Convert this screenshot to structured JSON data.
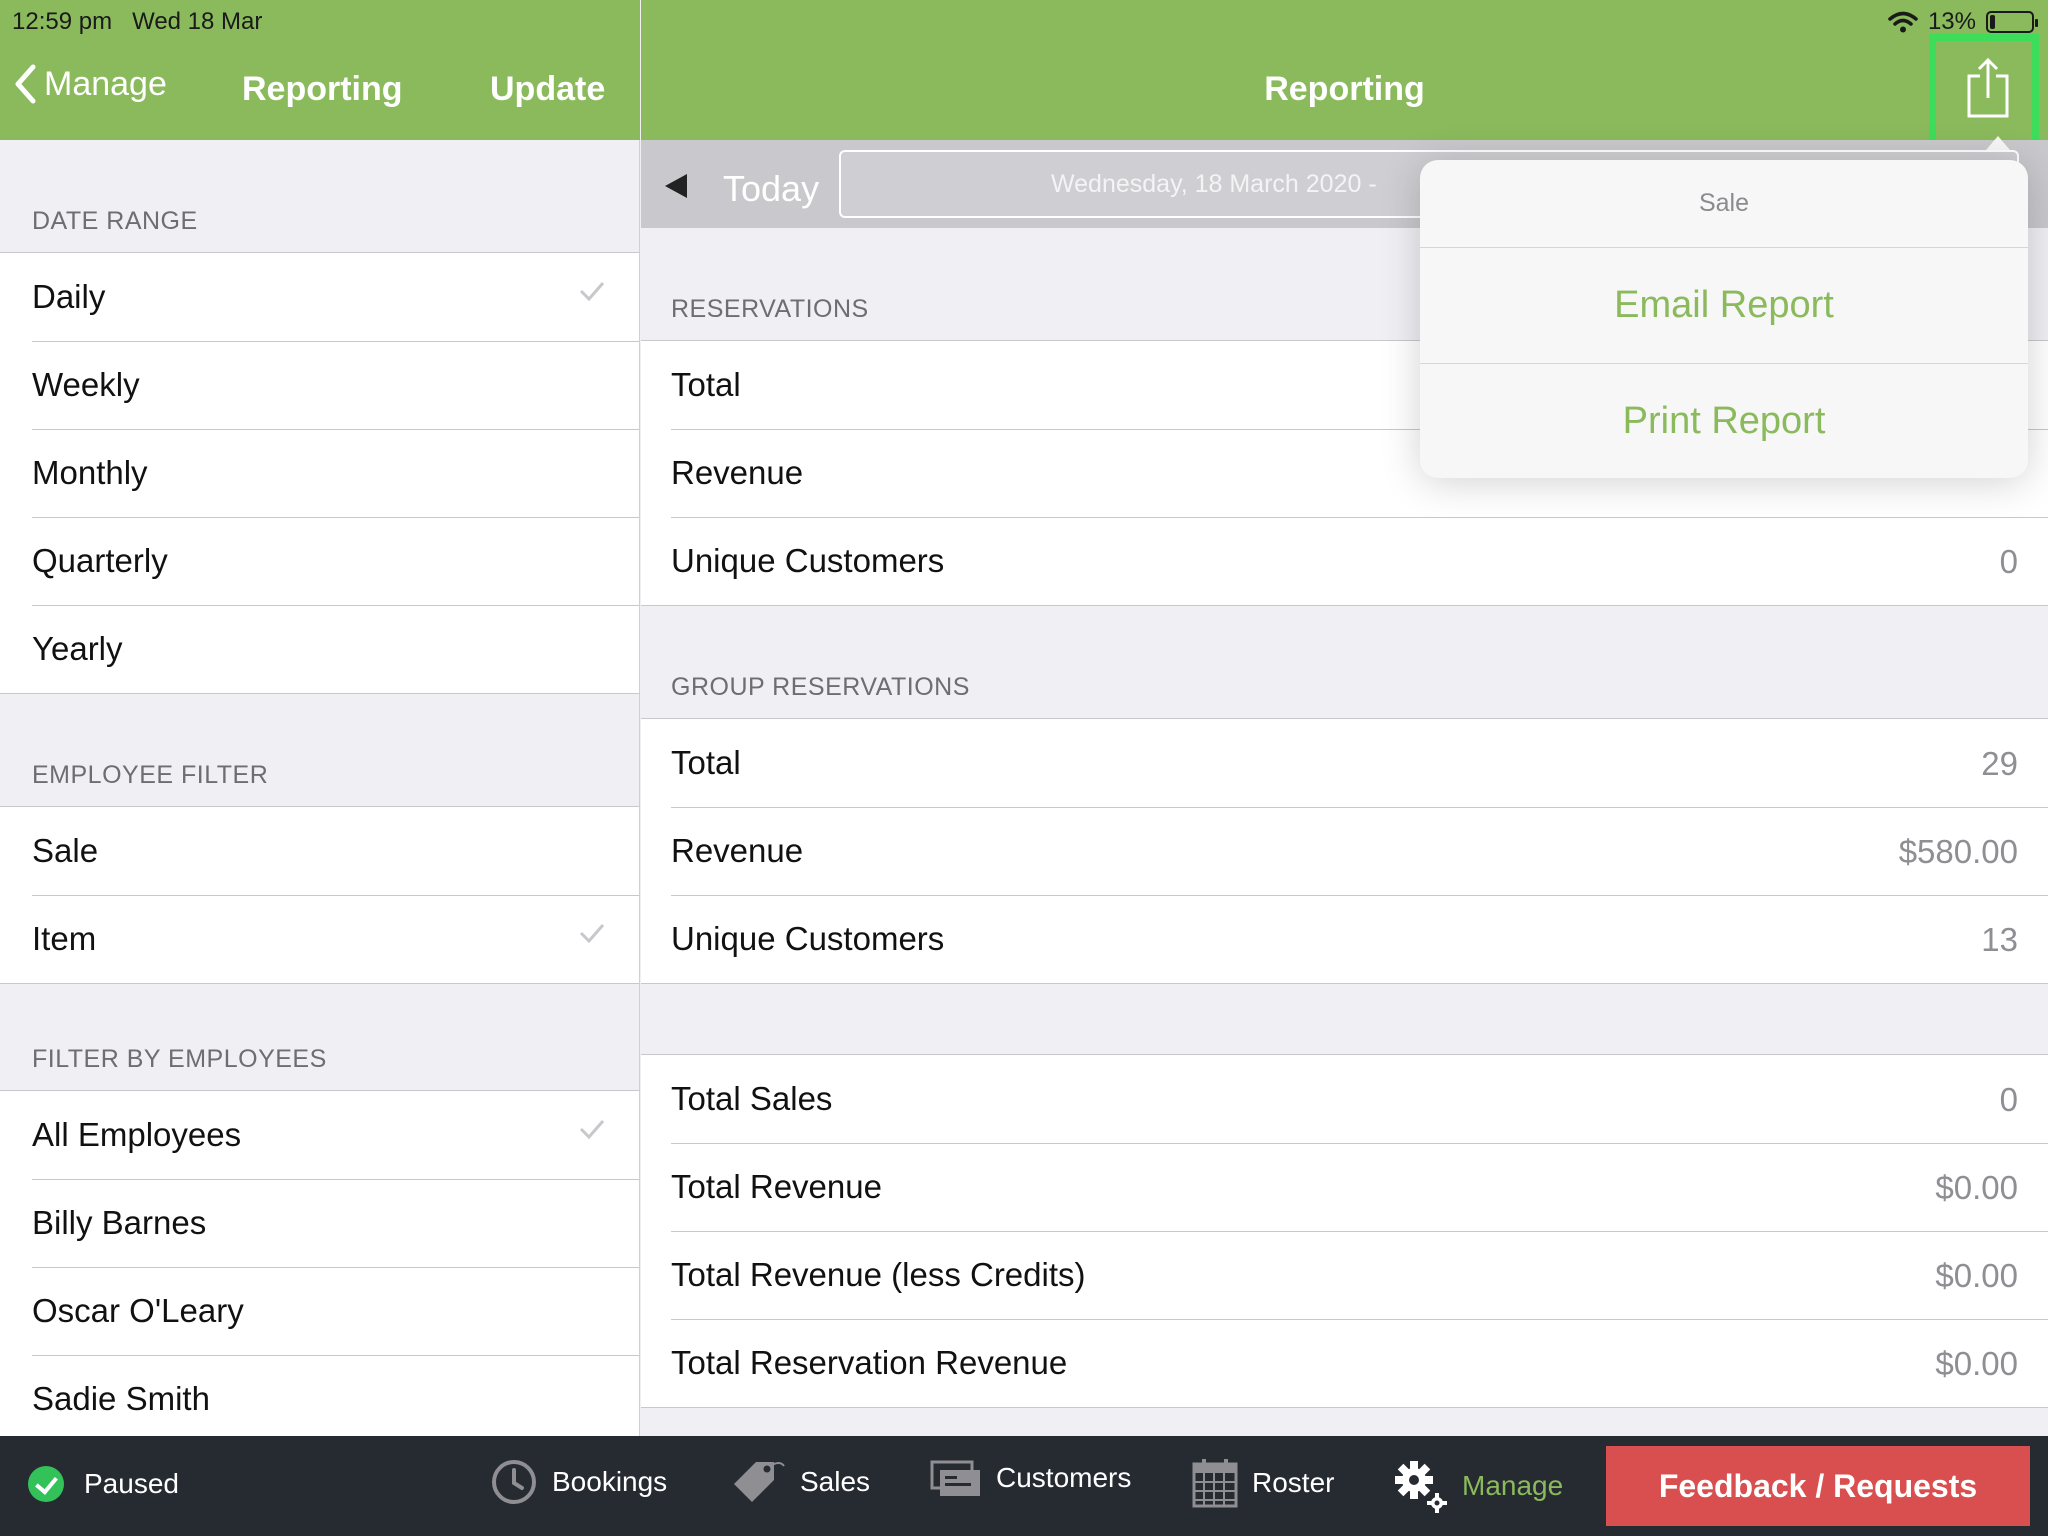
{
  "status_bar": {
    "time": "12:59 pm",
    "date": "Wed 18 Mar",
    "battery": "13%",
    "battery_level": 0.13
  },
  "left_header": {
    "back_label": "Manage",
    "title": "Reporting",
    "update_label": "Update"
  },
  "right_header": {
    "title": "Reporting"
  },
  "left_panel": {
    "date_range": {
      "header": "DATE RANGE",
      "items": [
        {
          "label": "Daily",
          "checked": true
        },
        {
          "label": "Weekly",
          "checked": false
        },
        {
          "label": "Monthly",
          "checked": false
        },
        {
          "label": "Quarterly",
          "checked": false
        },
        {
          "label": "Yearly",
          "checked": false
        }
      ]
    },
    "employee_filter": {
      "header": "EMPLOYEE FILTER",
      "items": [
        {
          "label": "Sale",
          "checked": false
        },
        {
          "label": "Item",
          "checked": true
        }
      ]
    },
    "filter_by_employees": {
      "header": "FILTER BY EMPLOYEES",
      "items": [
        {
          "label": "All Employees",
          "checked": true
        },
        {
          "label": "Billy Barnes",
          "checked": false
        },
        {
          "label": "Oscar O'Leary",
          "checked": false
        },
        {
          "label": "Sadie Smith",
          "checked": false
        }
      ]
    }
  },
  "date_bar": {
    "today_label": "Today",
    "date_text": "Wednesday, 18 March 2020 - "
  },
  "reservations": {
    "header": "RESERVATIONS",
    "rows": [
      {
        "label": "Total",
        "value": ""
      },
      {
        "label": "Revenue",
        "value": ""
      },
      {
        "label": "Unique Customers",
        "value": "0"
      }
    ]
  },
  "group_reservations": {
    "header": "GROUP RESERVATIONS",
    "rows": [
      {
        "label": "Total",
        "value": "29"
      },
      {
        "label": "Revenue",
        "value": "$580.00"
      },
      {
        "label": "Unique Customers",
        "value": "13"
      }
    ]
  },
  "sales_summary": {
    "rows": [
      {
        "label": "Total Sales",
        "value": "0"
      },
      {
        "label": "Total Revenue",
        "value": "$0.00"
      },
      {
        "label": "Total Revenue (less Credits)",
        "value": "$0.00"
      },
      {
        "label": "Total Reservation Revenue",
        "value": "$0.00"
      }
    ]
  },
  "popover": {
    "title": "Sale",
    "email_label": "Email Report",
    "print_label": "Print Report"
  },
  "tabbar": {
    "paused_label": "Paused",
    "tabs": [
      {
        "label": "Bookings",
        "icon": "clock-icon"
      },
      {
        "label": "Sales",
        "icon": "tag-icon"
      },
      {
        "label": "Customers",
        "icon": "customers-icon"
      },
      {
        "label": "Roster",
        "icon": "calendar-icon"
      },
      {
        "label": "Manage",
        "icon": "gear-icon"
      }
    ],
    "feedback_label": "Feedback / Requests"
  },
  "colors": {
    "brand_green": "#8aba5c",
    "feedback_red": "#d94f4f",
    "highlight": "#3ddc5a",
    "tabbar_bg": "#262a31"
  }
}
